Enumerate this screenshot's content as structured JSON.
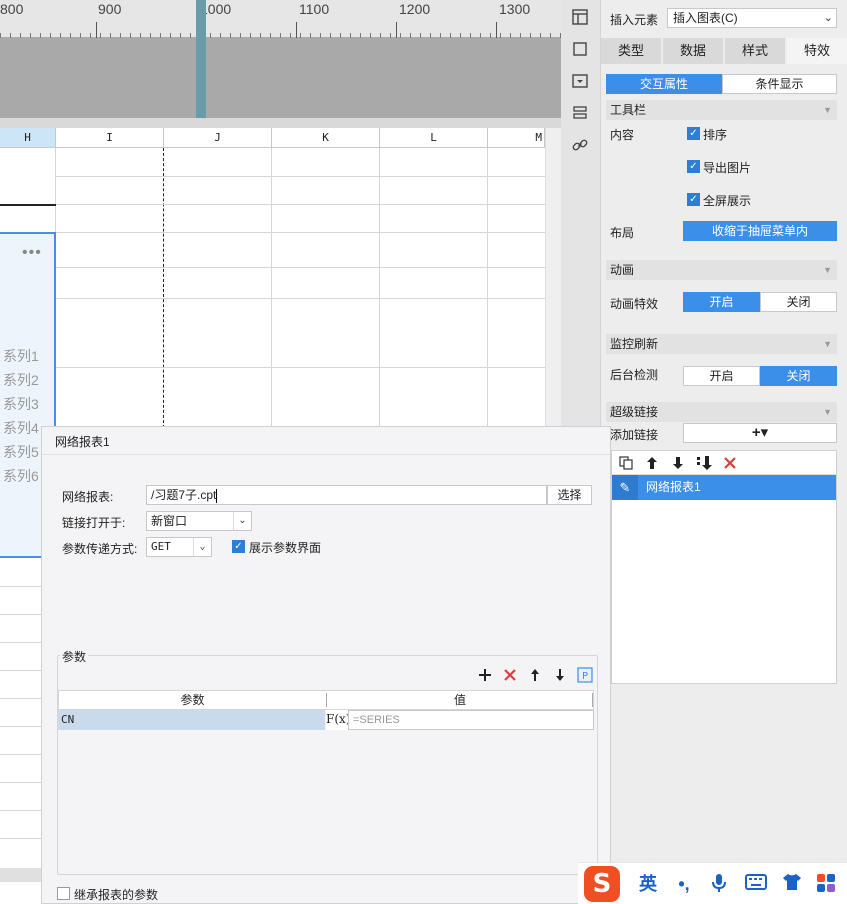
{
  "ruler": {
    "labels": [
      "800",
      "900",
      "1000",
      "1100",
      "1200",
      "1300"
    ]
  },
  "grid": {
    "columns": [
      "H",
      "I",
      "J",
      "K",
      "L",
      "M"
    ]
  },
  "chart": {
    "legend": [
      "系列1",
      "系列2",
      "系列3",
      "系列4",
      "系列5",
      "系列6"
    ]
  },
  "dialog": {
    "title": "网络报表1",
    "report_label": "网络报表:",
    "report_value": "/习题7子.cpt",
    "select_button": "选择",
    "open_in_label": "链接打开于:",
    "open_in_value": "新窗口",
    "param_method_label": "参数传递方式:",
    "param_method_value": "GET",
    "show_param_ui_label": "展示参数界面",
    "params_group": "参数",
    "table": {
      "col_param": "参数",
      "col_value": "值",
      "rows": [
        {
          "name": "CN",
          "fx": "F(x)",
          "value": "=SERIES"
        }
      ]
    },
    "inherit_label": "继承报表的参数"
  },
  "panel": {
    "insert_label": "插入元素",
    "insert_value": "插入图表(C)",
    "tabs": [
      "类型",
      "数据",
      "样式",
      "特效"
    ],
    "subtabs": [
      "交互属性",
      "条件显示"
    ],
    "toolbar_section": "工具栏",
    "content_label": "内容",
    "content_options": [
      "排序",
      "导出图片",
      "全屏展示"
    ],
    "layout_label": "布局",
    "layout_value": "收缩于抽屉菜单内",
    "animation_section": "动画",
    "animation_label": "动画特效",
    "on_label": "开启",
    "off_label": "关闭",
    "monitor_section": "监控刷新",
    "bg_check_label": "后台检测",
    "hyperlink_section": "超级链接",
    "add_link_label": "添加链接",
    "add_icon": "+▾",
    "link_items": [
      "网络报表1"
    ]
  },
  "ime": {
    "mode": "英",
    "logo": "S"
  },
  "colors": {
    "accent": "#3b8fe8",
    "selection": "#c9dbea",
    "delete": "#e03c3c"
  }
}
